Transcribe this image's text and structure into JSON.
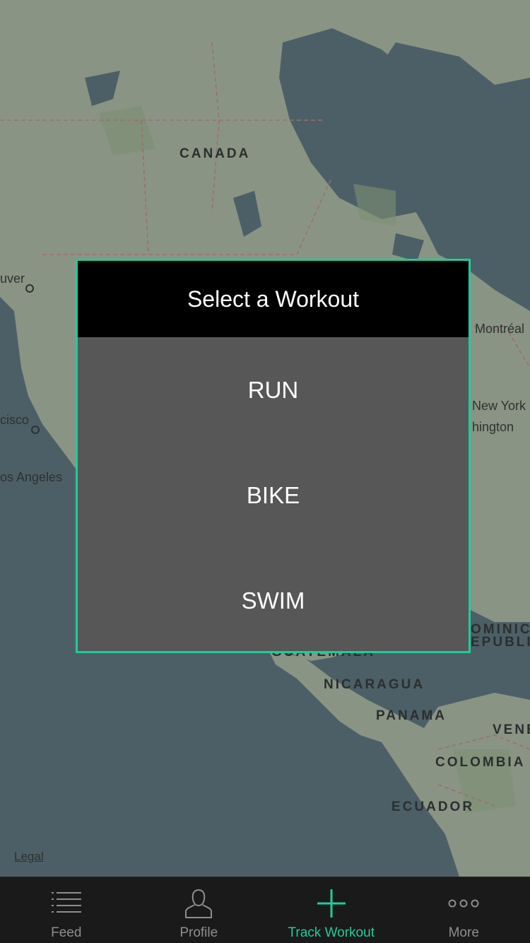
{
  "map": {
    "region_labels": {
      "canada": "CANADA",
      "guatemala": "GUATEMALA",
      "nicaragua": "NICARAGUA",
      "panama": "PANAMA",
      "colombia": "COLOMBIA",
      "ecuador": "ECUADOR",
      "venezuela": "VENE",
      "dominican_1": "OMINICA",
      "dominican_2": "EPUBLIC"
    },
    "city_labels": {
      "vancouver": "uver",
      "san_francisco": "cisco",
      "los_angeles": "os Angeles",
      "montreal": "Montréal",
      "new_york": "New York",
      "washington": "hington"
    },
    "legal": "Legal"
  },
  "modal": {
    "title": "Select a Workout",
    "options": [
      "RUN",
      "BIKE",
      "SWIM"
    ],
    "border_color": "#1fcc9a"
  },
  "tabbar": {
    "active_color": "#1fcc9a",
    "tabs": [
      {
        "label": "Feed",
        "icon": "list-icon"
      },
      {
        "label": "Profile",
        "icon": "person-icon"
      },
      {
        "label": "Track Workout",
        "icon": "plus-icon"
      },
      {
        "label": "More",
        "icon": "more-dots-icon"
      }
    ]
  }
}
